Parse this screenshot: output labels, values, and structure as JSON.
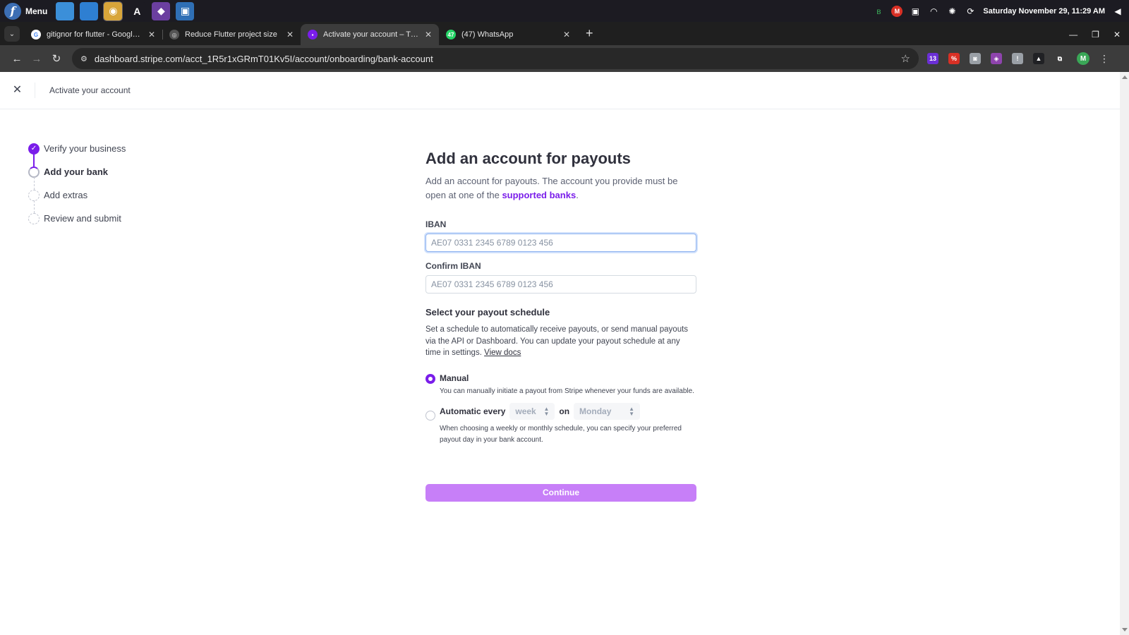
{
  "taskbar": {
    "menu_label": "Menu",
    "clock": "Saturday November 29, 11:29 AM",
    "apps": [
      {
        "name": "files-blue",
        "color": "#3b8fd9",
        "glyph": ""
      },
      {
        "name": "folder",
        "color": "#2e7fd2",
        "glyph": ""
      },
      {
        "name": "chrome",
        "color": "#d8a53a",
        "glyph": "◉"
      },
      {
        "name": "app-store",
        "color": "#1c1b22",
        "glyph": "A"
      },
      {
        "name": "github",
        "color": "#6b3fa0",
        "glyph": "◆"
      },
      {
        "name": "screenshot",
        "color": "#2f6fb5",
        "glyph": "▣"
      }
    ]
  },
  "tabs": [
    {
      "title": "gitignor for flutter - Google S",
      "favicon_glyph": "G",
      "favicon_color": "#ffffff",
      "favicon_text_color": "#4285f4",
      "active": false
    },
    {
      "title": "Reduce Flutter project size",
      "favicon_glyph": "◎",
      "favicon_color": "#555555",
      "favicon_text_color": "#dddddd",
      "active": false
    },
    {
      "title": "Activate your account – TWEN",
      "favicon_glyph": "▪",
      "favicon_color": "#7a1dea",
      "favicon_text_color": "#ffffff",
      "active": true
    },
    {
      "title": "(47) WhatsApp",
      "favicon_glyph": "47",
      "favicon_color": "#25d366",
      "favicon_text_color": "#ffffff",
      "active": false
    }
  ],
  "browser": {
    "url": "dashboard.stripe.com/acct_1R5r1xGRmT01Kv5I/account/onboarding/bank-account",
    "profile_initial": "M",
    "extensions": [
      {
        "name": "ext-badge-13",
        "color": "#6b2fd6",
        "glyph": "13"
      },
      {
        "name": "ext-red",
        "color": "#d93025",
        "glyph": "%"
      },
      {
        "name": "ext-camera",
        "color": "#9aa0a6",
        "glyph": "◙"
      },
      {
        "name": "ext-purple",
        "color": "#8e44ad",
        "glyph": "◈"
      },
      {
        "name": "ext-info",
        "color": "#9aa0a6",
        "glyph": "!"
      },
      {
        "name": "ext-triangle",
        "color": "#202124",
        "glyph": "▲"
      },
      {
        "name": "ext-puzzle",
        "color": "#3c3c3c",
        "glyph": "⧉"
      }
    ]
  },
  "page": {
    "header_title": "Activate your account",
    "steps": [
      {
        "label": "Verify your business",
        "state": "done"
      },
      {
        "label": "Add your bank",
        "state": "current"
      },
      {
        "label": "Add extras",
        "state": "todo"
      },
      {
        "label": "Review and submit",
        "state": "todo"
      }
    ],
    "form": {
      "title": "Add an account for payouts",
      "subtitle_prefix": "Add an account for payouts. The account you provide must be open at one of the ",
      "subtitle_link": "supported banks",
      "subtitle_suffix": ".",
      "iban_label": "IBAN",
      "iban_placeholder": "AE07 0331 2345 6789 0123 456",
      "confirm_iban_label": "Confirm IBAN",
      "confirm_iban_placeholder": "AE07 0331 2345 6789 0123 456",
      "schedule_title": "Select your payout schedule",
      "schedule_desc": "Set a schedule to automatically receive payouts, or send manual payouts via the API or Dashboard. You can update your payout schedule at any time in settings.",
      "view_docs": "View docs",
      "manual_label": "Manual",
      "manual_help": "You can manually initiate a payout from Stripe whenever your funds are available.",
      "automatic_label": "Automatic every",
      "interval_value": "week",
      "on_label": "on",
      "day_value": "Monday",
      "automatic_help": "When choosing a weekly or monthly schedule, you can specify your preferred payout day in your bank account.",
      "continue_label": "Continue"
    },
    "colors": {
      "accent": "#7a1dea",
      "button": "#c77ff8"
    }
  }
}
